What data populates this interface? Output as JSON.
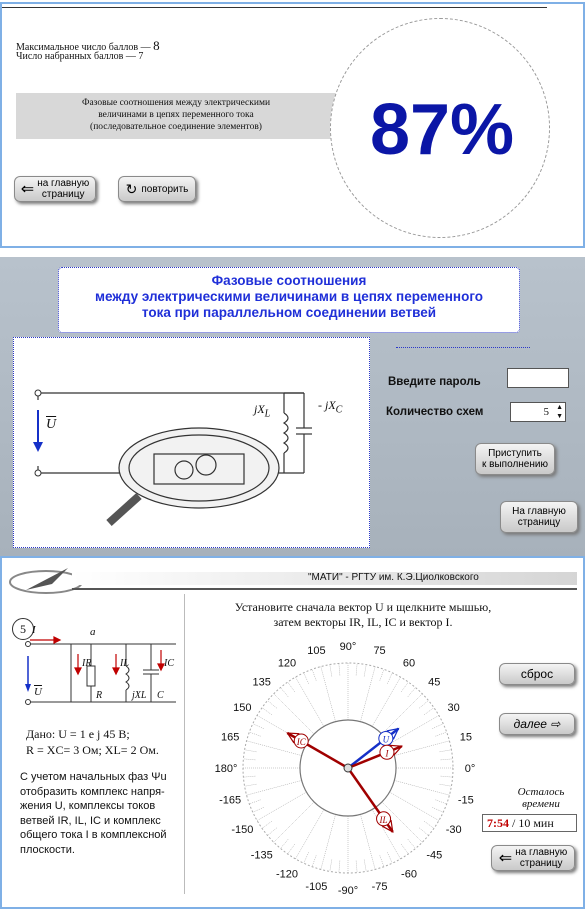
{
  "result": {
    "max_label": "Максимальное число баллов — ",
    "max_value": "8",
    "got_label": "Число  набранных  баллов — 7",
    "topic_line1": "Фазовые   соотношения  между  электрическими",
    "topic_line2": "величинами в цепях переменного тока",
    "topic_line3": "(последовательное соединение  элементов)",
    "percent": "87%",
    "home_line1": "на главную",
    "home_line2": "страницу",
    "repeat_label": "повторить"
  },
  "parallel": {
    "title_line1": "Фазовые соотношения",
    "title_line2": "между электрическими величинами в цепях переменного",
    "title_line3": "тока при параллельном соединении ветвей",
    "password_label": "Введите пароль",
    "password_value": "",
    "count_label": "Количество схем",
    "count_value": "5",
    "start_line1": "Приступить",
    "start_line2": "к выполнению",
    "home_line1": "На главную",
    "home_line2": "страницу",
    "circuit_u": "U",
    "circuit_jxl": "jX",
    "circuit_jxl_sub": "L",
    "circuit_jxc": "- jX",
    "circuit_jxc_sub": "C"
  },
  "task": {
    "header": "\"МАТИ\" - РГТУ им.  К.Э.Циолковского",
    "instruction_line1": "Установите сначала вектор U и щелкните мышью,",
    "instruction_line2": "затем векторы IR, IL, IC и вектор I.",
    "number": "5",
    "given_line1": "Дано:  U = 1 e j 45 B;",
    "given_line2": "R = XC= 3  Ом; XL= 2  Ом.",
    "desc_line1": "С учетом начальных фаз Ψu",
    "desc_line2": "отобразить комплекс напря-",
    "desc_line3": "жения U,  комплексы токов",
    "desc_line4": "ветвей IR, IL, IC и комплекс",
    "desc_line5": "общего тока I  в комплексной",
    "desc_line6": "плоскости.",
    "reset_label": "сброс",
    "next_label": "далее ⇨",
    "remaining_line1": "Осталось",
    "remaining_line2": "времени",
    "time_value": "7:54",
    "time_total": " / 10 мин",
    "home_line1": "на главную",
    "home_line2": "страницу",
    "circuit_labels": {
      "a": "a",
      "I": "I",
      "IR": "IR",
      "IL": "IL",
      "IC": "IC",
      "R": "R",
      "jXL": "jXL",
      "C": "C",
      "U": "U"
    },
    "angles": [
      "0°",
      "15",
      "30",
      "45",
      "60",
      "75",
      "90°",
      "105",
      "120",
      "135",
      "150",
      "165",
      "180°",
      "-165",
      "-150",
      "-135",
      "-120",
      "-105",
      "-90°",
      "-75",
      "-60",
      "-45",
      "-30",
      "-15"
    ],
    "vector_labels": {
      "IC": "IC",
      "U": "U",
      "IR": "I",
      "IL": "IL"
    }
  }
}
